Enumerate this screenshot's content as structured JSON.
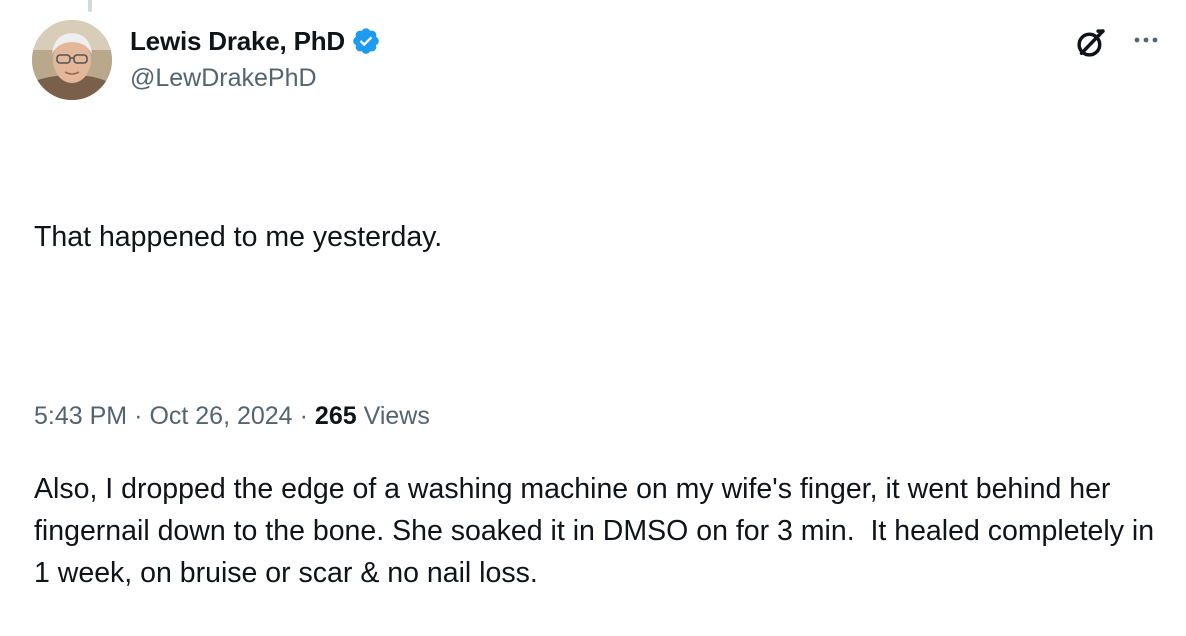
{
  "tweet": {
    "author": {
      "display_name": "Lewis Drake, PhD",
      "handle": "@LewDrakePhD",
      "verified": true,
      "verified_color": "#1d9bf0",
      "avatar_icon": "profile-photo"
    },
    "header_icons": {
      "grok": "grok-icon",
      "more": "more-horizontal-icon"
    },
    "paragraphs": [
      "That happened to me yesterday.",
      "Also, I dropped the edge of a washing machine on my wife's finger, it went behind her fingernail down to the bone. She soaked it in DMSO on for 3 min.  It healed completely in 1 week, on bruise or scar & no nail loss."
    ],
    "time": "5:43 PM",
    "separator": "·",
    "date": "Oct 26, 2024",
    "views_count": "265",
    "views_label": "Views"
  },
  "colors": {
    "text_primary": "#0f1419",
    "text_secondary": "#536471",
    "accent": "#1d9bf0"
  }
}
